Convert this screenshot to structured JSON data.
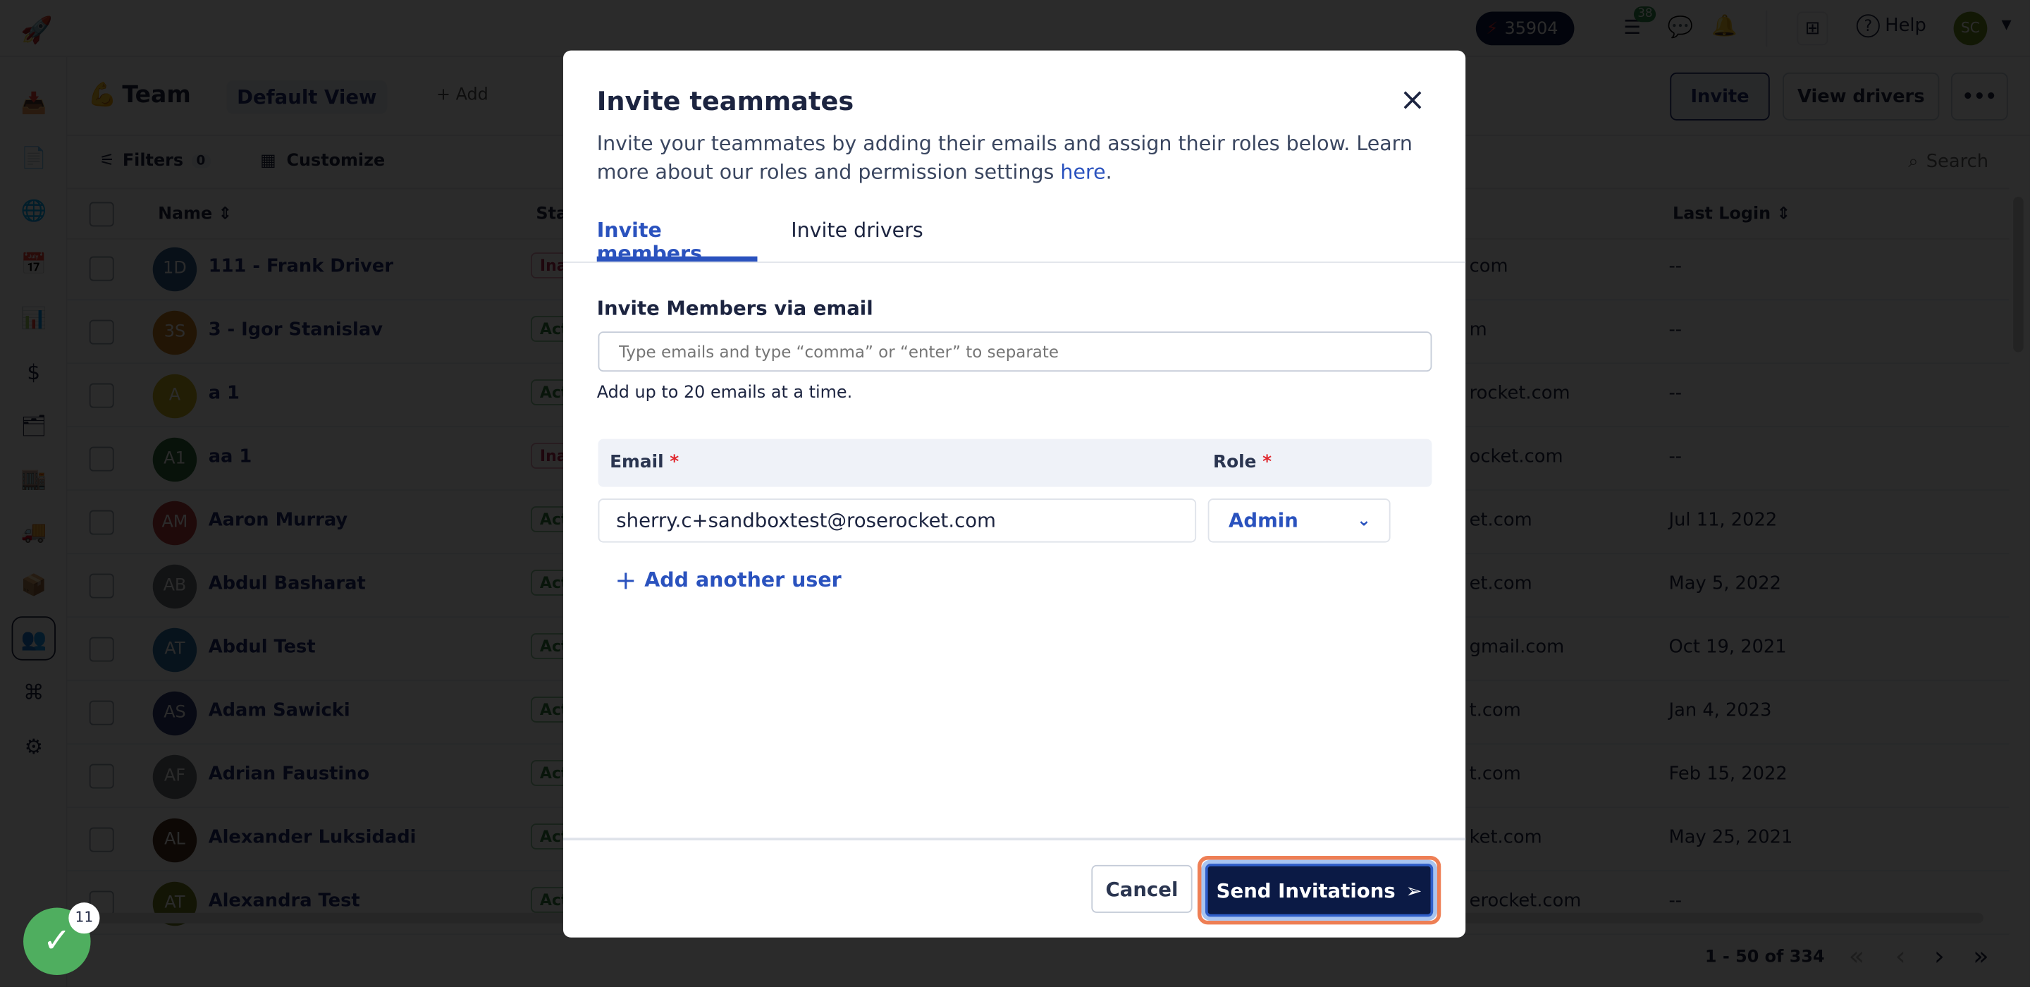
{
  "topbar": {
    "credits": "35904",
    "tasks_badge": "38",
    "help": "Help",
    "avatar": "SC",
    "icons": [
      "rocket-logo-icon",
      "bolt-icon",
      "tasks-icon",
      "chat-icon",
      "bell-icon",
      "apps-grid-icon",
      "help-icon",
      "caret-down-icon"
    ]
  },
  "sidebar": {
    "icons": [
      "inbox-icon",
      "orders-icon",
      "globe-icon",
      "calendar-icon",
      "reports-icon",
      "billing-icon",
      "documents-icon",
      "warehouse-icon",
      "truck-icon",
      "package-icon",
      "team-icon",
      "network-icon",
      "settings-icon"
    ],
    "active": "team-icon"
  },
  "header": {
    "emoji": "💪",
    "title": "Team",
    "view": "Default View",
    "add": "+ Add",
    "invite": "Invite",
    "view_drivers": "View drivers",
    "more": "•••"
  },
  "toolbar": {
    "filters": "Filters",
    "filters_count": "0",
    "customize": "Customize",
    "search": "Search"
  },
  "table": {
    "columns": {
      "name": "Name",
      "status": "Sta",
      "last_login": "Last Login"
    },
    "rows": [
      {
        "initials": "1D",
        "color": "#2e5d8f",
        "name": "111 - Frank Driver",
        "status": "Inactive",
        "email": "com",
        "last_login": "--"
      },
      {
        "initials": "3S",
        "color": "#c77a1c",
        "name": "3 - Igor Stanislav",
        "status": "Active",
        "email": "m",
        "last_login": "--"
      },
      {
        "initials": "A",
        "color": "#c9b21e",
        "name": "a 1",
        "status": "Active",
        "email": "rocket.com",
        "last_login": "--"
      },
      {
        "initials": "A1",
        "color": "#2f6b3c",
        "name": "aa 1",
        "status": "Inactive",
        "email": "ocket.com",
        "last_login": "--"
      },
      {
        "initials": "AM",
        "color": "#b43a3a",
        "name": "Aaron Murray",
        "status": "Active",
        "email": "et.com",
        "last_login": "Jul 11, 2022"
      },
      {
        "initials": "AB",
        "color": "#6b6f78",
        "name": "Abdul Basharat",
        "status": "Active",
        "email": "et.com",
        "last_login": "May 5, 2022"
      },
      {
        "initials": "AT",
        "color": "#2c6ea6",
        "name": "Abdul Test",
        "status": "Active",
        "email": "gmail.com",
        "last_login": "Oct 19, 2021"
      },
      {
        "initials": "AS",
        "color": "#2e3a78",
        "name": "Adam Sawicki",
        "status": "Active",
        "email": "t.com",
        "last_login": "Jan 4, 2023"
      },
      {
        "initials": "AF",
        "color": "#6b6f78",
        "name": "Adrian Faustino",
        "status": "Active",
        "email": "t.com",
        "last_login": "Feb 15, 2022"
      },
      {
        "initials": "AL",
        "color": "#4a2e1e",
        "name": "Alexander Luksidadi",
        "status": "Active",
        "email": "ket.com",
        "last_login": "May 25, 2021"
      },
      {
        "initials": "AT",
        "color": "#6e7a1e",
        "name": "Alexandra Test",
        "status": "Active",
        "email": "erocket.com",
        "last_login": "--"
      }
    ]
  },
  "pagination": {
    "range": "1 - 50 of 334",
    "first": "«",
    "prev": "‹",
    "next": "›",
    "last": "»"
  },
  "toast": {
    "count": "11"
  },
  "modal": {
    "title": "Invite teammates",
    "close": "×",
    "desc": "Invite your teammates by adding their emails and assign their roles below. Learn more about our roles and permission settings ",
    "link": "here",
    "desc_end": ".",
    "tabs": [
      {
        "label": "Invite members",
        "active": true
      },
      {
        "label": "Invite drivers",
        "active": false
      }
    ],
    "section_title": "Invite Members via email",
    "email_input_placeholder": "Type emails and type “comma” or “enter” to separate",
    "hint": "Add up to 20 emails at a time.",
    "col_email": "Email",
    "col_role": "Role",
    "required": "*",
    "rows": [
      {
        "email": "sherry.c+sandboxtest@roserocket.com",
        "role": "Admin"
      }
    ],
    "add_user": "Add another user",
    "cancel": "Cancel",
    "send": "Send Invitations"
  },
  "colors": {
    "accent": "#2a52be",
    "primary_button": "#0b1a45",
    "focus_ring": "#ee7f55",
    "required": "#e0282e"
  }
}
